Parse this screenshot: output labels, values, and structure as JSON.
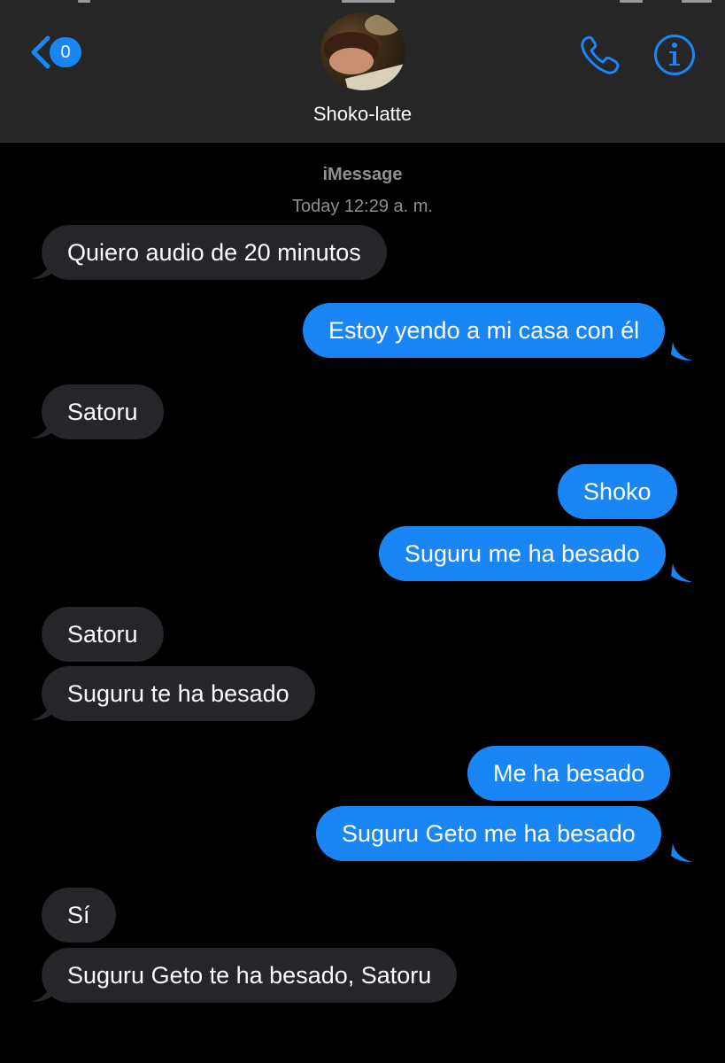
{
  "header": {
    "back_badge": "0",
    "contact_name": "Shoko-latte",
    "icons": {
      "back": "chevron-left-icon",
      "phone": "phone-icon",
      "info": "info-icon"
    },
    "accent_color": "#1a86f5"
  },
  "conversation": {
    "service": "iMessage",
    "timestamp": "Today 12:29 a. m.",
    "messages": [
      {
        "direction": "incoming",
        "text": "Quiero audio de 20 minutos"
      },
      {
        "direction": "outgoing",
        "text": "Estoy yendo a mi casa con él"
      },
      {
        "direction": "incoming",
        "text": "Satoru"
      },
      {
        "direction": "outgoing",
        "text": "Shoko"
      },
      {
        "direction": "outgoing",
        "text": "Suguru me ha besado"
      },
      {
        "direction": "incoming",
        "text": "Satoru"
      },
      {
        "direction": "incoming",
        "text": "Suguru te ha besado"
      },
      {
        "direction": "outgoing",
        "text": "Me ha besado"
      },
      {
        "direction": "outgoing",
        "text": "Suguru Geto me ha besado"
      },
      {
        "direction": "incoming",
        "text": "Sí"
      },
      {
        "direction": "incoming",
        "text": "Suguru Geto te ha besado, Satoru"
      }
    ],
    "colors": {
      "incoming_bubble": "#26252a",
      "outgoing_bubble": "#1a86f5",
      "meta_text": "#8e8e93"
    }
  }
}
